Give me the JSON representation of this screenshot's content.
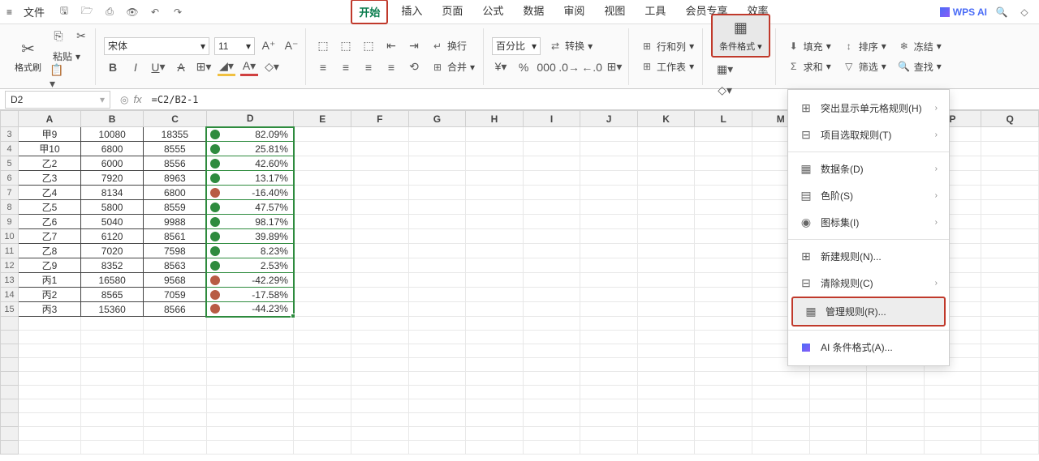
{
  "topbar": {
    "file_label": "文件",
    "tabs": [
      "开始",
      "插入",
      "页面",
      "公式",
      "数据",
      "审阅",
      "视图",
      "工具",
      "会员专享",
      "效率"
    ],
    "active_tab_index": 0,
    "wps_ai": "WPS AI"
  },
  "ribbon": {
    "format_painter": "格式刷",
    "paste": "粘贴",
    "font_name": "宋体",
    "font_size": "11",
    "wrap": "换行",
    "merge": "合并",
    "number_format": "百分比",
    "convert": "转换",
    "rows_cols": "行和列",
    "worksheet": "工作表",
    "cond_format": "条件格式",
    "fill": "填充",
    "sum": "求和",
    "sort": "排序",
    "filter": "筛选",
    "freeze": "冻结",
    "find": "查找"
  },
  "formula_bar": {
    "cell_ref": "D2",
    "formula": "=C2/B2-1"
  },
  "columns": [
    "A",
    "B",
    "C",
    "D",
    "E",
    "F",
    "G",
    "H",
    "I",
    "J",
    "K",
    "L",
    "M",
    "N",
    "O",
    "P",
    "Q"
  ],
  "row_start": 3,
  "data_rows": [
    {
      "a": "甲9",
      "b": "10080",
      "c": "18355",
      "d": "82.09%",
      "dot": "green"
    },
    {
      "a": "甲10",
      "b": "6800",
      "c": "8555",
      "d": "25.81%",
      "dot": "green"
    },
    {
      "a": "乙2",
      "b": "6000",
      "c": "8556",
      "d": "42.60%",
      "dot": "green"
    },
    {
      "a": "乙3",
      "b": "7920",
      "c": "8963",
      "d": "13.17%",
      "dot": "green"
    },
    {
      "a": "乙4",
      "b": "8134",
      "c": "6800",
      "d": "-16.40%",
      "dot": "red"
    },
    {
      "a": "乙5",
      "b": "5800",
      "c": "8559",
      "d": "47.57%",
      "dot": "green"
    },
    {
      "a": "乙6",
      "b": "5040",
      "c": "9988",
      "d": "98.17%",
      "dot": "green"
    },
    {
      "a": "乙7",
      "b": "6120",
      "c": "8561",
      "d": "39.89%",
      "dot": "green"
    },
    {
      "a": "乙8",
      "b": "7020",
      "c": "7598",
      "d": "8.23%",
      "dot": "green"
    },
    {
      "a": "乙9",
      "b": "8352",
      "c": "8563",
      "d": "2.53%",
      "dot": "green"
    },
    {
      "a": "丙1",
      "b": "16580",
      "c": "9568",
      "d": "-42.29%",
      "dot": "red"
    },
    {
      "a": "丙2",
      "b": "8565",
      "c": "7059",
      "d": "-17.58%",
      "dot": "red"
    },
    {
      "a": "丙3",
      "b": "15360",
      "c": "8566",
      "d": "-44.23%",
      "dot": "red"
    }
  ],
  "empty_rows_after": 10,
  "dropdown": {
    "items": [
      {
        "icon": "⊞",
        "label": "突出显示单元格规则(H)",
        "arrow": true
      },
      {
        "icon": "⊟",
        "label": "项目选取规则(T)",
        "arrow": true
      },
      {
        "sep": true
      },
      {
        "icon": "▦",
        "label": "数据条(D)",
        "arrow": true
      },
      {
        "icon": "▤",
        "label": "色阶(S)",
        "arrow": true
      },
      {
        "icon": "◉",
        "label": "图标集(I)",
        "arrow": true
      },
      {
        "sep": true
      },
      {
        "icon": "⊞",
        "label": "新建规则(N)...",
        "arrow": false
      },
      {
        "icon": "⊟",
        "label": "清除规则(C)",
        "arrow": true
      },
      {
        "icon": "▦",
        "label": "管理规则(R)...",
        "arrow": false,
        "highlight": true
      },
      {
        "sep": true
      },
      {
        "icon": "ai",
        "label": "AI 条件格式(A)...",
        "arrow": false
      }
    ]
  }
}
